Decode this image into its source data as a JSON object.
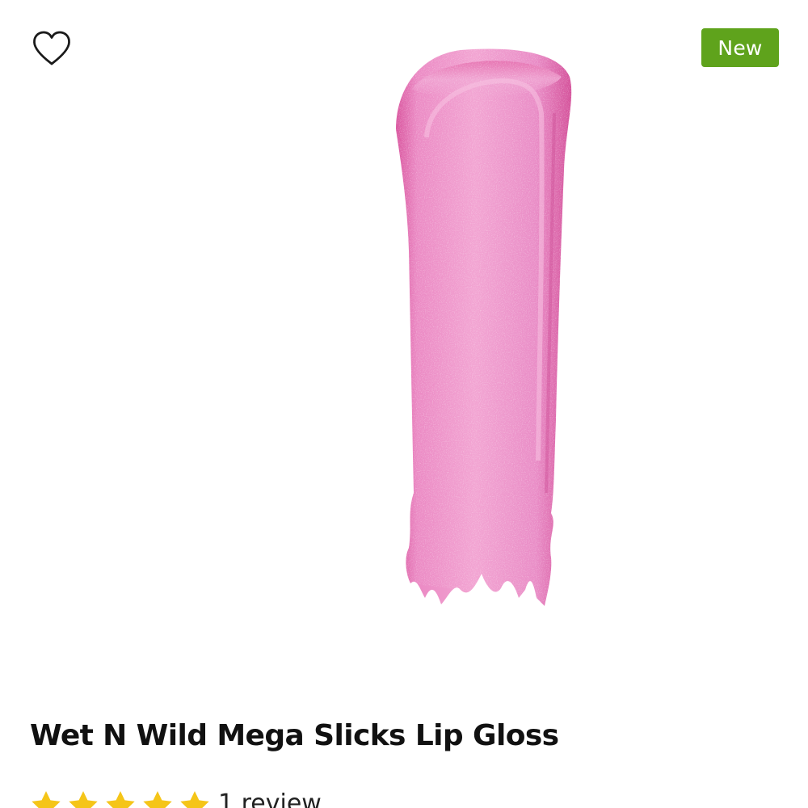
{
  "badge": {
    "label": "New",
    "color": "#5fa31c"
  },
  "wishlist": {
    "icon": "heart-outline-icon"
  },
  "product": {
    "image_alt": "Wet N Wild Mega Slicks Lip Gloss swatch",
    "swatch_color": "#e77fc0",
    "title": "Wet N Wild Mega Slicks Lip Gloss"
  },
  "rating": {
    "stars": 5,
    "max_stars": 5,
    "star_color": "#f5c518",
    "review_count_label": "1 review"
  }
}
